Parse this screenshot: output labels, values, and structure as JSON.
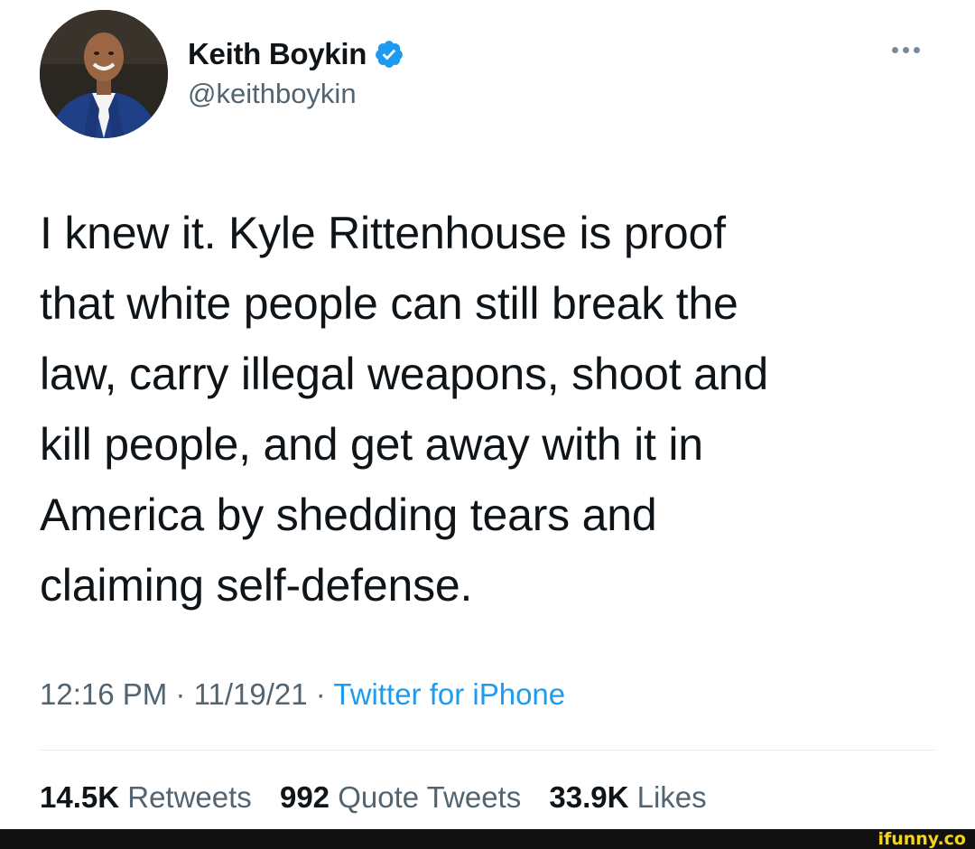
{
  "author": {
    "display_name": "Keith Boykin",
    "handle": "@keithboykin",
    "verified_icon": "verified-badge-icon",
    "colors": {
      "verified": "#1d9bf0"
    }
  },
  "tweet": {
    "lines": [
      "I knew it. Kyle Rittenhouse is proof",
      "that white people can still break the",
      "law, carry illegal weapons, shoot and",
      "kill people, and get away with it in",
      "America by shedding tears and",
      "claiming self-defense."
    ]
  },
  "meta": {
    "time": "12:16 PM",
    "separator": "·",
    "date": "11/19/21",
    "source": "Twitter for iPhone",
    "source_color": "#1d9bf0"
  },
  "stats": {
    "retweets_count": "14.5K",
    "retweets_label": "Retweets",
    "quotes_count": "992",
    "quotes_label": "Quote Tweets",
    "likes_count": "33.9K",
    "likes_label": "Likes"
  },
  "watermark": {
    "text": "ifunny.co",
    "color": "#f5d51c"
  },
  "icons": {
    "more": "more-options-icon",
    "avatar": "avatar"
  }
}
